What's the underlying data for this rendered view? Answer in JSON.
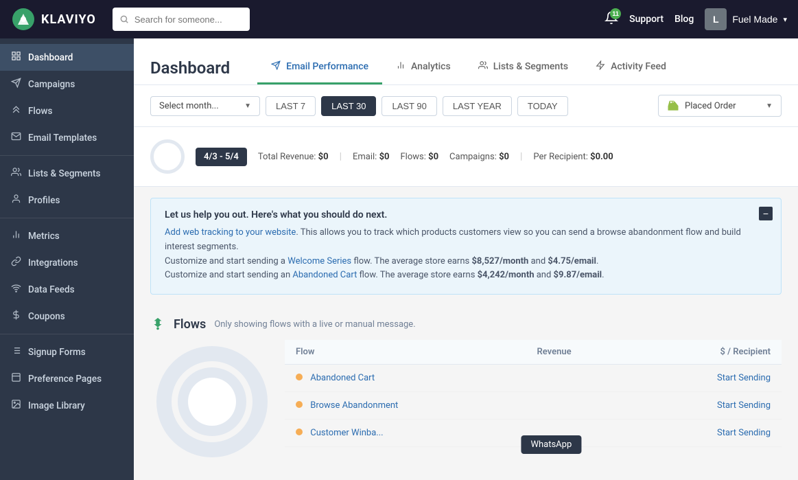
{
  "topnav": {
    "logo_text": "KLAVIYO",
    "search_placeholder": "Search for someone...",
    "notification_count": "11",
    "support_label": "Support",
    "blog_label": "Blog",
    "user_initial": "L",
    "user_name": "Fuel Made",
    "chevron": "▾"
  },
  "sidebar": {
    "items": [
      {
        "id": "dashboard",
        "label": "Dashboard",
        "icon": "⊞",
        "active": true
      },
      {
        "id": "campaigns",
        "label": "Campaigns",
        "icon": "✈"
      },
      {
        "id": "flows",
        "label": "Flows",
        "icon": "⟶"
      },
      {
        "id": "email-templates",
        "label": "Email Templates",
        "icon": "✉"
      },
      {
        "id": "lists-segments",
        "label": "Lists & Segments",
        "icon": "👥"
      },
      {
        "id": "profiles",
        "label": "Profiles",
        "icon": "👤"
      },
      {
        "id": "metrics",
        "label": "Metrics",
        "icon": "📊"
      },
      {
        "id": "integrations",
        "label": "Integrations",
        "icon": "🔗"
      },
      {
        "id": "data-feeds",
        "label": "Data Feeds",
        "icon": "📡"
      },
      {
        "id": "coupons",
        "label": "Coupons",
        "icon": "💲"
      },
      {
        "id": "signup-forms",
        "label": "Signup Forms",
        "icon": "≡"
      },
      {
        "id": "preference-pages",
        "label": "Preference Pages",
        "icon": "🖼"
      },
      {
        "id": "image-library",
        "label": "Image Library",
        "icon": "🏞"
      }
    ]
  },
  "dashboard": {
    "title": "Dashboard",
    "tabs": [
      {
        "id": "email-performance",
        "label": "Email Performance",
        "icon": "✈",
        "active": true
      },
      {
        "id": "analytics",
        "label": "Analytics",
        "icon": "📊"
      },
      {
        "id": "lists-segments",
        "label": "Lists & Segments",
        "icon": "👥"
      },
      {
        "id": "activity-feed",
        "label": "Activity Feed",
        "icon": "⚡"
      }
    ]
  },
  "controls": {
    "select_month_label": "Select month...",
    "time_buttons": [
      {
        "id": "last7",
        "label": "LAST 7",
        "active": false
      },
      {
        "id": "last30",
        "label": "LAST 30",
        "active": true
      },
      {
        "id": "last90",
        "label": "LAST 90",
        "active": false
      },
      {
        "id": "last-year",
        "label": "LAST YEAR",
        "active": false
      },
      {
        "id": "today",
        "label": "TODAY",
        "active": false
      }
    ],
    "event_label": "Placed Order"
  },
  "stats": {
    "date_range": "4/3 - 5/4",
    "total_revenue_label": "Total Revenue:",
    "total_revenue": "$0",
    "email_label": "Email:",
    "email_value": "$0",
    "flows_label": "Flows:",
    "flows_value": "$0",
    "campaigns_label": "Campaigns:",
    "campaigns_value": "$0",
    "per_recipient_label": "Per Recipient:",
    "per_recipient_value": "$0.00"
  },
  "infobox": {
    "title": "Let us help you out. Here's what you should do next.",
    "tracking_link_text": "Add web tracking to your website",
    "tracking_desc": ". This allows you to track which products customers view so you can send a browse abandonment flow and build interest segments.",
    "welcome_prefix": "Customize and start sending a ",
    "welcome_link_text": "Welcome Series",
    "welcome_suffix": " flow. The average store earns ",
    "welcome_amount1": "$8,527/month",
    "welcome_and": " and ",
    "welcome_amount2": "$4.75/email",
    "welcome_end": ".",
    "abandoned_prefix": "Customize and start sending an ",
    "abandoned_link_text": "Abandoned Cart",
    "abandoned_suffix": " flow. The average store earns ",
    "abandoned_amount1": "$4,242/month",
    "abandoned_and": " and ",
    "abandoned_amount2": "$9.87/email",
    "abandoned_end": "."
  },
  "flows_section": {
    "title": "Flows",
    "subtitle": "Only showing flows with a live or manual message.",
    "table_headers": [
      "Flow",
      "Revenue",
      "$ / Recipient"
    ],
    "rows": [
      {
        "name": "Abandoned Cart",
        "revenue": "",
        "per_recipient": "",
        "action": "Start Sending"
      },
      {
        "name": "Browse Abandonment",
        "revenue": "",
        "per_recipient": "",
        "action": "Start Sending"
      },
      {
        "name": "Customer Winba...",
        "revenue": "",
        "per_recipient": "",
        "action": "Start Sending"
      }
    ]
  },
  "whatsapp_tooltip": {
    "label": "WhatsApp"
  }
}
